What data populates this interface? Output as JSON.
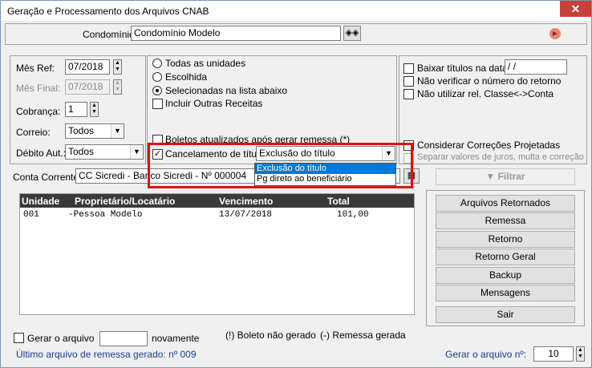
{
  "window": {
    "title": "Geração e Processamento dos Arquivos CNAB",
    "close": "✕"
  },
  "condominio": {
    "label": "Condomínio:",
    "value": "Condomínio Modelo"
  },
  "left": {
    "mes_ref_label": "Mês Ref:",
    "mes_ref_value": "07/2018",
    "mes_final_label": "Mês Final:",
    "mes_final_value": "07/2018",
    "cobranca_label": "Cobrança:",
    "cobranca_value": "1",
    "correio_label": "Correio:",
    "correio_value": "Todos",
    "debito_label": "Débito Aut.:",
    "debito_value": "Todos"
  },
  "middle": {
    "todas": "Todas as unidades",
    "escolhida": "Escolhida",
    "selecionadas": "Selecionadas na lista abaixo",
    "incluir": "Incluir Outras Receitas",
    "boletos": "Boletos atualizados após gerar remessa (*)",
    "cancelamento": "Cancelamento de título",
    "cancelamento_value": "Exclusão do título",
    "dropdown_options": [
      "Exclusão do título",
      "Pg direto ao beneficiário"
    ]
  },
  "right": {
    "baixar": "Baixar títulos na data:",
    "baixar_value": " / /",
    "nao_verificar": "Não verificar o número do retorno",
    "nao_utilizar": "Não utilizar rel. Classe<->Conta",
    "considerar": "Considerar Correções Projetadas",
    "separar": "Separar valores de juros, multa e correção"
  },
  "conta": {
    "label": "Conta Corrente:",
    "value": "CC Sicredi - Banco Sicredi - Nº 000004"
  },
  "filtrar": "Filtrar",
  "grid": {
    "headers": [
      "Unidade",
      "Proprietário/Locatário",
      "Vencimento",
      "Total"
    ],
    "rows": [
      {
        "unidade": "001",
        "prop": "-Pessoa Modelo",
        "venc": "13/07/2018",
        "total": "101,00"
      }
    ]
  },
  "buttons": [
    "Arquivos Retornados",
    "Remessa",
    "Retorno",
    "Retorno Geral",
    "Backup",
    "Mensagens",
    "Sair"
  ],
  "bottom": {
    "gerar": "Gerar o arquivo",
    "novamente": "novamente",
    "boleto_nao": "(!) Boleto não gerado",
    "remessa_gerada": "(-) Remessa gerada",
    "ultimo": "Último arquivo de remessa gerado: nº 009",
    "gerar_n_label": "Gerar o arquivo nº:",
    "gerar_n_value": "10"
  }
}
